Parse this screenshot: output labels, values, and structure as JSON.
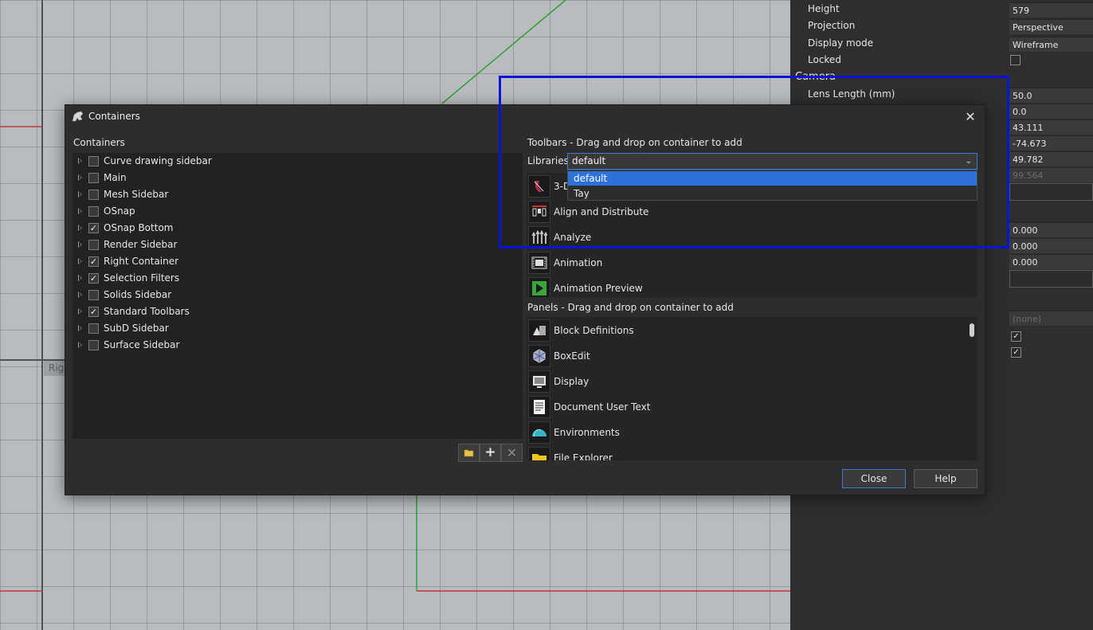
{
  "viewport": {
    "label": "Rig"
  },
  "properties": {
    "rows": [
      {
        "label": "Height",
        "value": "579"
      },
      {
        "label": "Projection",
        "value": "Perspective"
      },
      {
        "label": "Display mode",
        "value": "Wireframe"
      },
      {
        "label": "Locked",
        "value": ""
      }
    ],
    "camera_section": "Camera",
    "lens_label": "Lens Length (mm)",
    "lens_value": "50.0",
    "values": [
      "0.0",
      "43.111",
      "-74.673",
      "49.782",
      "99.564"
    ],
    "target_values": [
      "0.000",
      "0.000",
      "0.000"
    ],
    "none_value": "(none)"
  },
  "dialog": {
    "title": "Containers",
    "containers_header": "Containers",
    "containers": [
      {
        "label": "Curve drawing sidebar",
        "checked": false
      },
      {
        "label": "Main",
        "checked": false
      },
      {
        "label": "Mesh Sidebar",
        "checked": false
      },
      {
        "label": "OSnap",
        "checked": false
      },
      {
        "label": "OSnap Bottom",
        "checked": true
      },
      {
        "label": "Render Sidebar",
        "checked": false
      },
      {
        "label": "Right Container",
        "checked": true
      },
      {
        "label": "Selection Filters",
        "checked": true
      },
      {
        "label": "Solids Sidebar",
        "checked": false
      },
      {
        "label": "Standard Toolbars",
        "checked": true
      },
      {
        "label": "SubD Sidebar",
        "checked": false
      },
      {
        "label": "Surface Sidebar",
        "checked": false
      }
    ],
    "check_glyph": "✓",
    "toolbars_header": "Toolbars - Drag and drop on container to add",
    "libraries_label": "Libraries",
    "library_selected": "default",
    "library_options": [
      "default",
      "Tay"
    ],
    "toolbars": [
      "3-D",
      "Align and Distribute",
      "Analyze",
      "Animation",
      "Animation Preview"
    ],
    "panels_header": "Panels - Drag and drop on container to add",
    "panels": [
      "Block Definitions",
      "BoxEdit",
      "Display",
      "Document User Text",
      "Environments",
      "File Explorer"
    ],
    "buttons": {
      "close": "Close",
      "help": "Help"
    }
  }
}
